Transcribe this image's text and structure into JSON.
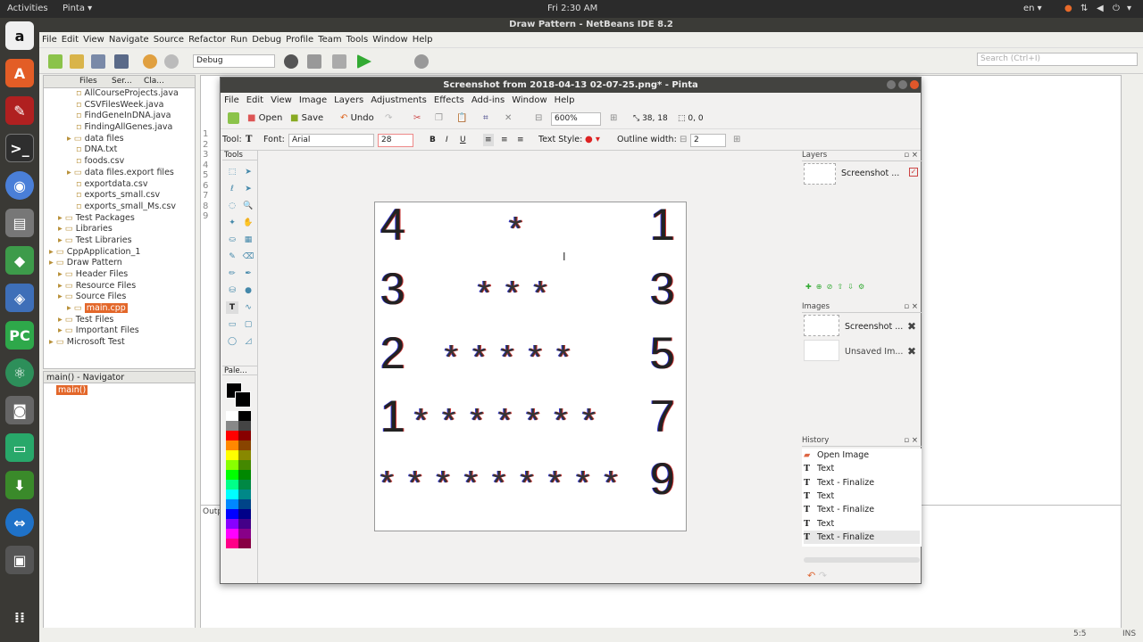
{
  "top_bar": {
    "activities": "Activities",
    "app_menu": "Pinta ▾",
    "clock": "Fri  2:30 AM",
    "lang": "en ▾"
  },
  "netbeans": {
    "title": "Draw Pattern - NetBeans IDE 8.2",
    "menu": [
      "File",
      "Edit",
      "View",
      "Navigate",
      "Source",
      "Refactor",
      "Run",
      "Debug",
      "Profile",
      "Team",
      "Tools",
      "Window",
      "Help"
    ],
    "config": "Debug",
    "search_placeholder": "Search (Ctrl+I)",
    "project_tabs": [
      "Files",
      "Ser...",
      "Cla..."
    ],
    "tree": [
      {
        "label": "AllCourseProjects.java",
        "indent": 3
      },
      {
        "label": "CSVFilesWeek.java",
        "indent": 3
      },
      {
        "label": "FindGeneInDNA.java",
        "indent": 3
      },
      {
        "label": "FindingAllGenes.java",
        "indent": 3
      },
      {
        "label": "data files",
        "indent": 2
      },
      {
        "label": "DNA.txt",
        "indent": 3
      },
      {
        "label": "foods.csv",
        "indent": 3
      },
      {
        "label": "data files.export files",
        "indent": 2
      },
      {
        "label": "exportdata.csv",
        "indent": 3
      },
      {
        "label": "exports_small.csv",
        "indent": 3
      },
      {
        "label": "exports_small_Ms.csv",
        "indent": 3
      },
      {
        "label": "Test Packages",
        "indent": 1
      },
      {
        "label": "Libraries",
        "indent": 1
      },
      {
        "label": "Test Libraries",
        "indent": 1
      },
      {
        "label": "CppApplication_1",
        "indent": 0
      },
      {
        "label": "Draw Pattern",
        "indent": 0
      },
      {
        "label": "Header Files",
        "indent": 1
      },
      {
        "label": "Resource Files",
        "indent": 1
      },
      {
        "label": "Source Files",
        "indent": 1
      },
      {
        "label": "main.cpp",
        "indent": 2,
        "selected": true
      },
      {
        "label": "Test Files",
        "indent": 1
      },
      {
        "label": "Important Files",
        "indent": 1
      },
      {
        "label": "Microsoft Test",
        "indent": 0
      }
    ],
    "navigator_title": "main() - Navigator",
    "navigator_item": "main()",
    "line_numbers": [
      "1",
      "2",
      "3",
      "4",
      "5",
      "6",
      "7",
      "8",
      "9"
    ],
    "output_tab": "Outp",
    "status_pos": "5:5",
    "status_mode": "INS"
  },
  "pinta": {
    "title": "Screenshot from 2018-04-13 02-07-25.png* - Pinta",
    "menu": [
      "File",
      "Edit",
      "View",
      "Image",
      "Layers",
      "Adjustments",
      "Effects",
      "Add-ins",
      "Window",
      "Help"
    ],
    "toolbar": {
      "open": "Open",
      "save": "Save",
      "undo": "Undo",
      "zoom": "600%",
      "cursor_pos": "38, 18",
      "selection_size": "0, 0"
    },
    "text_toolbar": {
      "tool_label": "Tool:",
      "font_label": "Font:",
      "font": "Arial",
      "size": "28",
      "text_style_label": "Text Style:",
      "outline_label": "Outline width:",
      "outline": "2"
    },
    "tools_header": "Tools",
    "palette_header": "Pale...",
    "layers_header": "Layers",
    "layer_name": "Screenshot ...",
    "images_header": "Images",
    "images": [
      "Screenshot ...",
      "Unsaved Im..."
    ],
    "history_header": "History",
    "history": [
      "Open Image",
      "Text",
      "Text - Finalize",
      "Text",
      "Text - Finalize",
      "Text",
      "Text - Finalize"
    ],
    "canvas": {
      "rows": [
        {
          "left": "4",
          "stars": "*",
          "right": "1"
        },
        {
          "left": "3",
          "stars": "* * *",
          "right": "3"
        },
        {
          "left": "2",
          "stars": "* * * * *",
          "right": "5"
        },
        {
          "left": "1",
          "stars": "* * * * * * *",
          "right": "7"
        },
        {
          "left": "",
          "stars": "* * * * * * * * *",
          "right": "9"
        }
      ]
    }
  }
}
